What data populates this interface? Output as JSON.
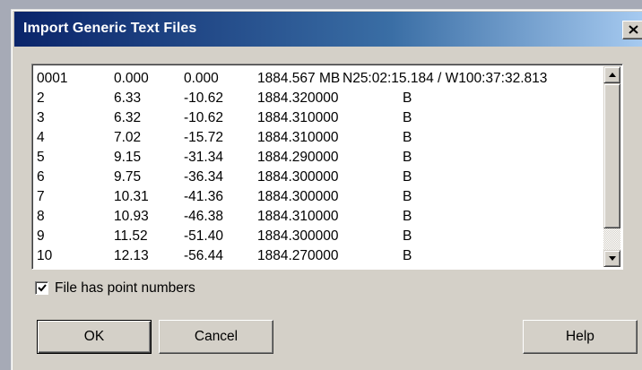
{
  "window": {
    "title": "Import Generic Text Files",
    "close_icon": "close-icon"
  },
  "listbox": {
    "rows": [
      [
        "0001",
        "0.000",
        "0.000",
        "1884.567 MB",
        "N25:02:15.184 / W100:37:32.813"
      ],
      [
        "2",
        "6.33",
        "-10.62",
        "1884.320000",
        "B"
      ],
      [
        "3",
        "6.32",
        "-10.62",
        "1884.310000",
        "B"
      ],
      [
        "4",
        "7.02",
        "-15.72",
        "1884.310000",
        "B"
      ],
      [
        "5",
        "9.15",
        "-31.34",
        "1884.290000",
        "B"
      ],
      [
        "6",
        "9.75",
        "-36.34",
        "1884.300000",
        "B"
      ],
      [
        "7",
        "10.31",
        "-41.36",
        "1884.300000",
        "B"
      ],
      [
        "8",
        "10.93",
        "-46.38",
        "1884.310000",
        "B"
      ],
      [
        "9",
        "11.52",
        "-51.40",
        "1884.300000",
        "B"
      ],
      [
        "10",
        "12.13",
        "-56.44",
        "1884.270000",
        "B"
      ]
    ]
  },
  "checkbox": {
    "label": "File has point numbers",
    "checked": true
  },
  "buttons": {
    "ok": "OK",
    "cancel": "Cancel",
    "help": "Help"
  }
}
